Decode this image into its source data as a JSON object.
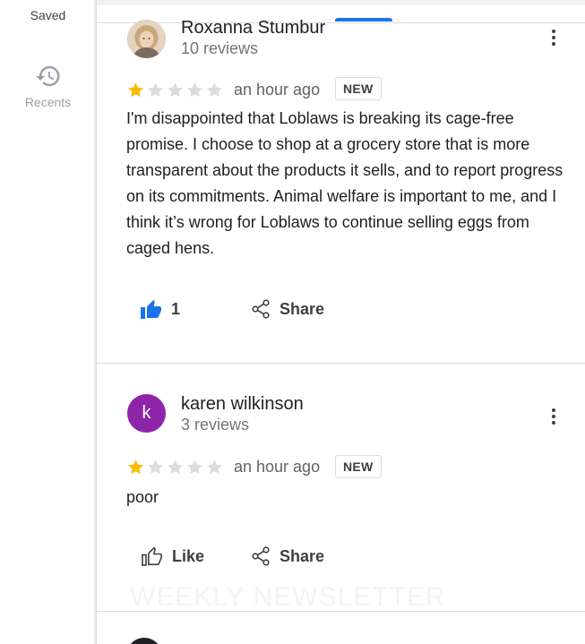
{
  "rail": {
    "saved_label": "Saved",
    "recents_label": "Recents",
    "recents_icon": "history-icon"
  },
  "colors": {
    "accent": "#1a73e8",
    "star_filled": "#fbbc04",
    "star_empty": "#dadce0",
    "avatar_letter_bg": "#8e24aa"
  },
  "reviews": [
    {
      "author": "Roxanna Stumbur",
      "review_count": "10 reviews",
      "rating": 1,
      "max_rating": 5,
      "time_ago": "an hour ago",
      "badge": "NEW",
      "text": "I'm disappointed that Loblaws is breaking its cage-free promise. I choose to shop at a grocery store that is more transparent about the products it sells, and to report progress on its commitments. Animal welfare is important to me, and I think it’s wrong for Loblaws to continue selling eggs from caged hens.",
      "like_count": "1",
      "share_label": "Share"
    },
    {
      "author": "karen wilkinson",
      "avatar_letter": "k",
      "review_count": "3 reviews",
      "rating": 1,
      "max_rating": 5,
      "time_ago": "an hour ago",
      "badge": "NEW",
      "text": "poor",
      "like_label": "Like",
      "share_label": "Share"
    }
  ],
  "watermark": "WEEKLY NEWSLETTER"
}
